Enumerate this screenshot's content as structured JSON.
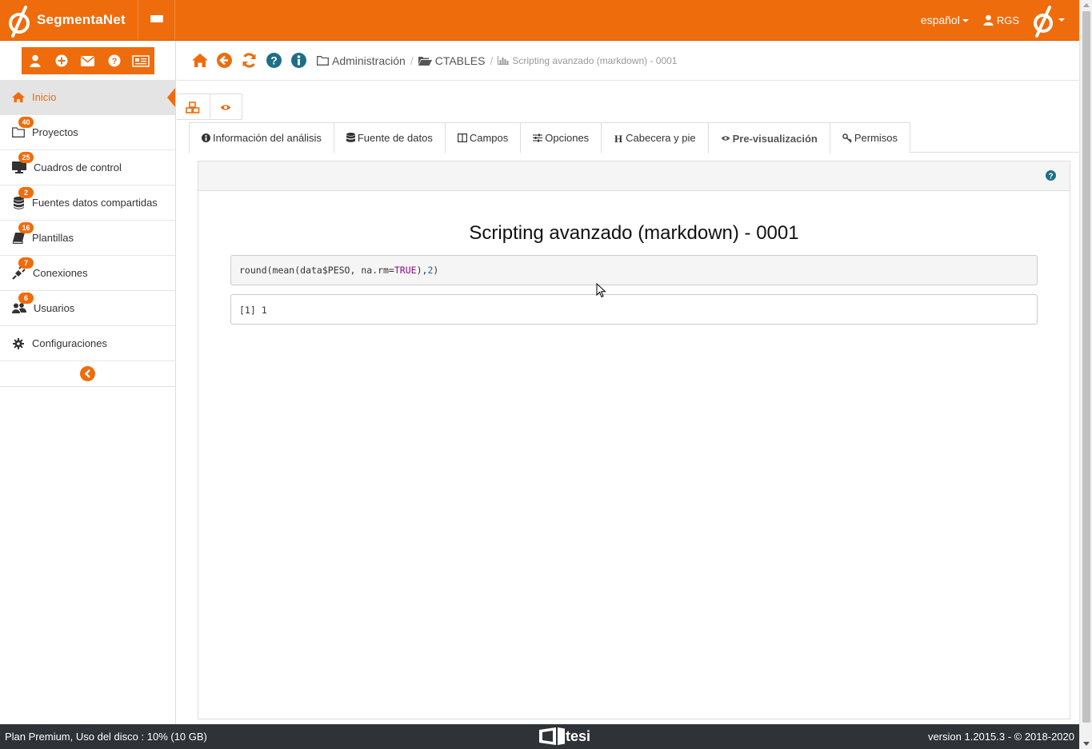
{
  "app": {
    "brand": "SegmentaNet",
    "language": "español",
    "user": "RGS"
  },
  "sidebar": {
    "quick_icons": [
      "user-icon",
      "plus-circle-icon",
      "envelope-icon",
      "help-icon",
      "newspaper-icon"
    ],
    "items": [
      {
        "label": "Inicio",
        "icon": "home-icon",
        "badge": ""
      },
      {
        "label": "Proyectos",
        "icon": "folder-icon",
        "badge": "40"
      },
      {
        "label": "Cuadros de control",
        "icon": "monitor-icon",
        "badge": "25"
      },
      {
        "label": "Fuentes datos compartidas",
        "icon": "database-icon",
        "badge": "2"
      },
      {
        "label": "Plantillas",
        "icon": "book-icon",
        "badge": "16"
      },
      {
        "label": "Conexiones",
        "icon": "plug-icon",
        "badge": "7"
      },
      {
        "label": "Usuarios",
        "icon": "users-icon",
        "badge": "6"
      },
      {
        "label": "Configuraciones",
        "icon": "gear-icon",
        "badge": ""
      }
    ]
  },
  "breadcrumb": {
    "items": [
      "Administración",
      "CTABLES"
    ],
    "current": "Scripting avanzado (markdown) - 0001"
  },
  "tabs": [
    {
      "label": "Información del análisis",
      "icon": "info-icon",
      "active": false
    },
    {
      "label": "Fuente de datos",
      "icon": "database-icon",
      "active": false
    },
    {
      "label": "Campos",
      "icon": "columns-icon",
      "active": false
    },
    {
      "label": "Opciones",
      "icon": "sliders-icon",
      "active": false
    },
    {
      "label": "Cabecera y pie",
      "icon": "header-icon",
      "active": false
    },
    {
      "label": "Pre-visualización",
      "icon": "eye-icon",
      "active": true
    },
    {
      "label": "Permisos",
      "icon": "key-icon",
      "active": false
    }
  ],
  "report": {
    "title": "Scripting avanzado (markdown) - 0001",
    "code_prefix": "round(mean(data$PESO, na.rm=",
    "code_keyword": "TRUE",
    "code_mid": "),",
    "code_number": "2",
    "code_suffix": ")",
    "output": "[1] 1"
  },
  "footer": {
    "plan": "Plan Premium, Uso del disco : 10% (10 GB)",
    "vendor": "tesi",
    "version": "version 1.2015.3 - © 2018-2020"
  },
  "colors": {
    "accent": "#ef6c0c",
    "footer_bg": "#2f3338",
    "help_blue": "#1d6f87"
  }
}
